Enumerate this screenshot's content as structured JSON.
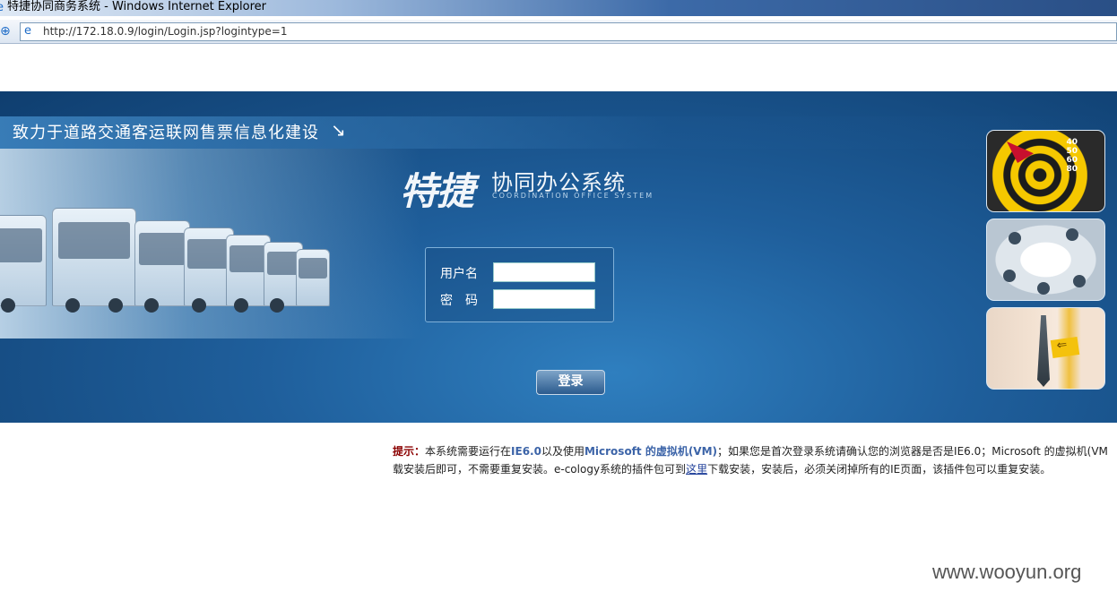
{
  "window": {
    "title": "特捷协同商务系统 - Windows Internet Explorer",
    "url": "http://172.18.0.9/login/Login.jsp?logintype=1",
    "icons": [
      "ie-icon",
      "nav-icon",
      "site-icon"
    ]
  },
  "banner": {
    "slogan": "致力于道路交通客运联网售票信息化建设",
    "slogan_arrow": "↘",
    "logo": {
      "brand": "特捷",
      "system_name": "协同办公系统",
      "system_name_en": "COORDINATION OFFICE SYSTEM"
    },
    "dartboard_numbers": [
      "40",
      "50",
      "60",
      "80"
    ]
  },
  "login": {
    "username_label": "用户名",
    "password_label": "密　码",
    "username_value": "",
    "password_value": "",
    "submit_label": "登录"
  },
  "tip": {
    "label": "提示：",
    "line1_a": "本系统需要运行在",
    "ie_version": "IE6.0",
    "line1_b": "以及使用",
    "vm_name": "Microsoft 的虚拟机(VM)",
    "line1_c": "；如果您是首次登录系统请确认您的浏览器是否是IE6.0；Microsoft 的虚拟机(VM",
    "line2_a": "载安装后即可，不需要重复安装。e-cology系统的插件包可到",
    "link_text": "这里",
    "line2_b": "下载安装，安装后，必须关闭掉所有的IE页面，该插件包可以重复安装。"
  },
  "watermark": "www.wooyun.org",
  "colors": {
    "banner_dark": "#0f3e6f",
    "banner_light": "#2f7fbf",
    "tip_label": "#8b0000",
    "tip_highlight": "#3c64a8"
  }
}
